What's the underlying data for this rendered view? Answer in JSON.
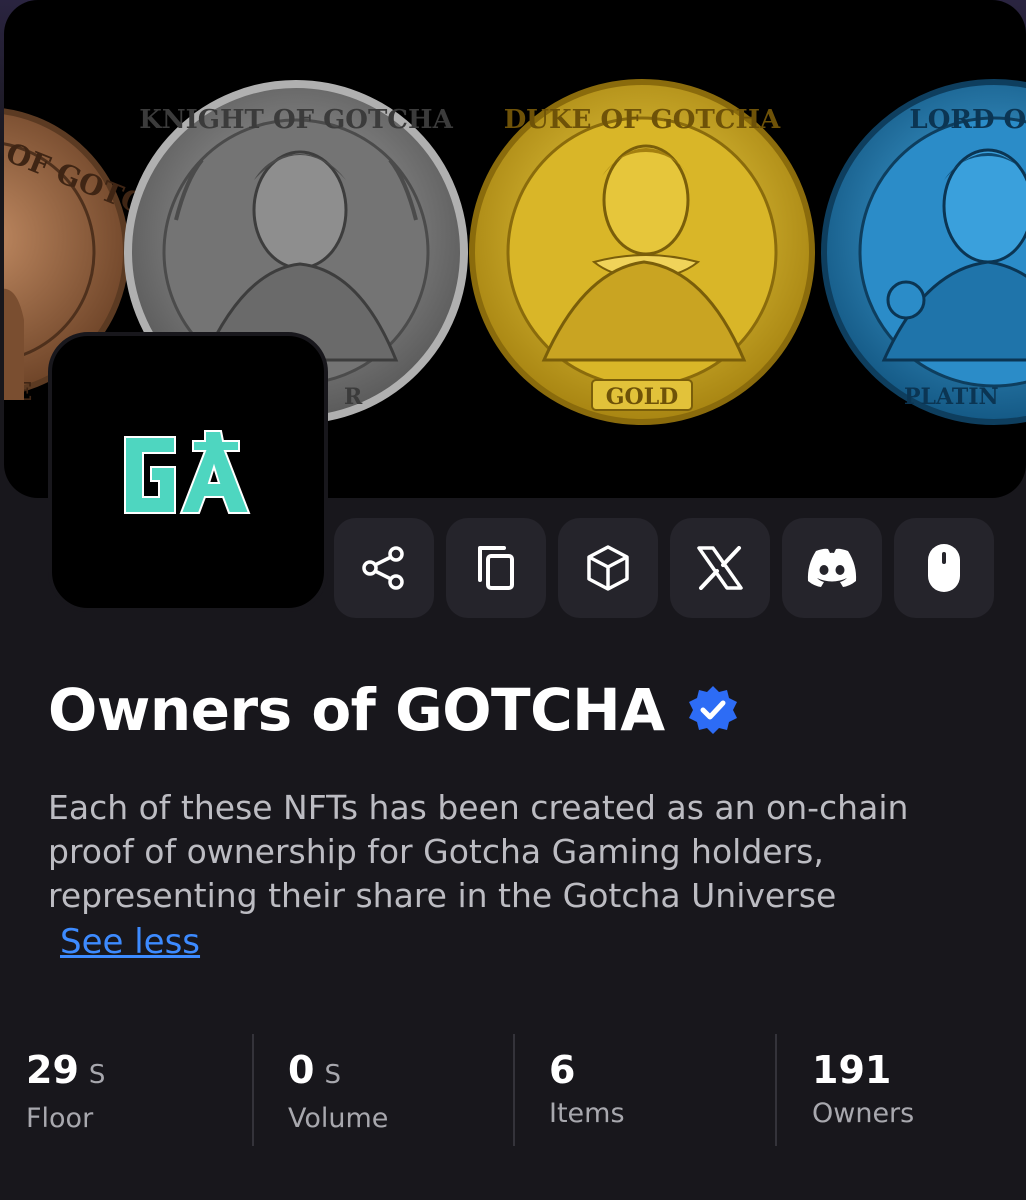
{
  "banner": {
    "coins": [
      {
        "name": "bronze",
        "label": "OF GOTCHA",
        "bottom": "E",
        "color": "#9a6a4a"
      },
      {
        "name": "silver",
        "label": "KNIGHT OF GOTCHA",
        "bottom": "R",
        "color": "#8c8c8c"
      },
      {
        "name": "gold",
        "label": "DUKE OF GOTCHA",
        "bottom": "GOLD",
        "color": "#d4b52e"
      },
      {
        "name": "platinum",
        "label": "LORD OF GO",
        "bottom": "PLATIN",
        "color": "#2f86c6"
      }
    ]
  },
  "collection": {
    "logo_text": "GA",
    "title": "Owners of GOTCHA",
    "verified_icon": "verified-badge-icon",
    "description": "Each of these NFTs has been created as an on-chain proof of ownership for Gotcha Gaming holders, representing their share in the Gotcha Universe",
    "see_less": "See less"
  },
  "actions": [
    {
      "name": "share-icon"
    },
    {
      "name": "copy-icon"
    },
    {
      "name": "cube-icon"
    },
    {
      "name": "x-icon"
    },
    {
      "name": "discord-icon"
    },
    {
      "name": "mouse-icon"
    }
  ],
  "stats": [
    {
      "value": "29",
      "unit": "S",
      "label": "Floor"
    },
    {
      "value": "0",
      "unit": "S",
      "label": "Volume"
    },
    {
      "value": "6",
      "unit": "",
      "label": "Items"
    },
    {
      "value": "191",
      "unit": "",
      "label": "Owners"
    }
  ],
  "colors": {
    "accent_link": "#3d8bff",
    "verified": "#2d6cf5",
    "logo_teal": "#4ed6c0"
  }
}
